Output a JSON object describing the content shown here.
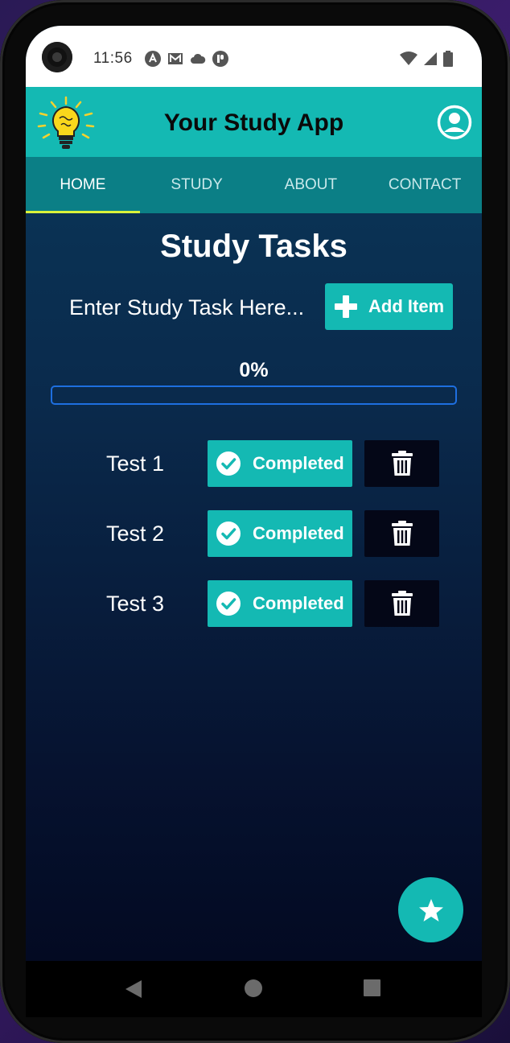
{
  "status_bar": {
    "time": "11:56",
    "notification_icons": [
      "a-app-icon",
      "mail-icon",
      "cloud-icon",
      "t-app-icon"
    ],
    "system_icons": [
      "wifi-icon",
      "signal-icon",
      "battery-icon"
    ]
  },
  "app_bar": {
    "title": "Your Study App",
    "logo_icon": "lightbulb-icon",
    "account_icon": "account-circle-icon",
    "color": "#14b9b3"
  },
  "tabs": [
    {
      "label": "HOME",
      "active": true
    },
    {
      "label": "STUDY",
      "active": false
    },
    {
      "label": "ABOUT",
      "active": false
    },
    {
      "label": "CONTACT",
      "active": false
    }
  ],
  "main": {
    "title": "Study Tasks",
    "task_input": {
      "placeholder": "Enter Study Task Here...",
      "value": ""
    },
    "add_button": {
      "label": "Add Item",
      "icon": "plus-icon"
    },
    "progress": {
      "label": "0%",
      "value": 0
    },
    "tasks": [
      {
        "name": "Test 1",
        "status_label": "Completed"
      },
      {
        "name": "Test 2",
        "status_label": "Completed"
      },
      {
        "name": "Test 3",
        "status_label": "Completed"
      }
    ]
  },
  "fab": {
    "icon": "star-icon"
  },
  "nav_bar": {
    "buttons": [
      "back-icon",
      "home-icon",
      "recents-icon"
    ]
  },
  "colors": {
    "accent": "#14b9b3",
    "tab_bar": "#0b7f86",
    "tab_indicator": "#d9f23a",
    "progress": "#1e6fe0",
    "delete_button": "#040717"
  }
}
